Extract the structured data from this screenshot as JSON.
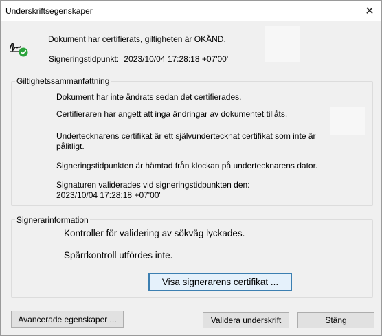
{
  "window": {
    "title": "Underskriftsegenskaper",
    "close_glyph": "✕"
  },
  "header": {
    "icon": "signature-valid-icon",
    "status": "Dokument har certifierats, giltigheten är OKÄND.",
    "signing_time_label": "Signeringstidpunkt:",
    "signing_time_value": "2023/10/04 17:28:18 +07'00'"
  },
  "validity_summary": {
    "label": "Giltighetssammanfattning",
    "lines": [
      "Dokument har inte ändrats sedan det certifierades.",
      "Certifieraren har angett att inga ändringar av dokumentet tillåts.",
      "Undertecknarens certifikat är ett självundertecknat certifikat som inte är pålitligt.",
      "Signeringstidpunkten är hämtad från klockan på undertecknarens dator.",
      "Signaturen validerades vid signeringstidpunkten den:",
      "2023/10/04 17:28:18 +07'00'"
    ]
  },
  "signer_info": {
    "label": "Signerarinformation",
    "lines": [
      "Kontroller för validering av sökväg lyckades.",
      "Spärrkontroll utfördes inte."
    ],
    "show_certificate_button": "Visa signerarens certifikat ..."
  },
  "footer": {
    "advanced_button": "Avancerade egenskaper ...",
    "validate_button": "Validera underskrift",
    "close_button": "Stäng"
  },
  "colors": {
    "accent_border": "#3c7fb1",
    "check_green": "#2aa33b"
  }
}
